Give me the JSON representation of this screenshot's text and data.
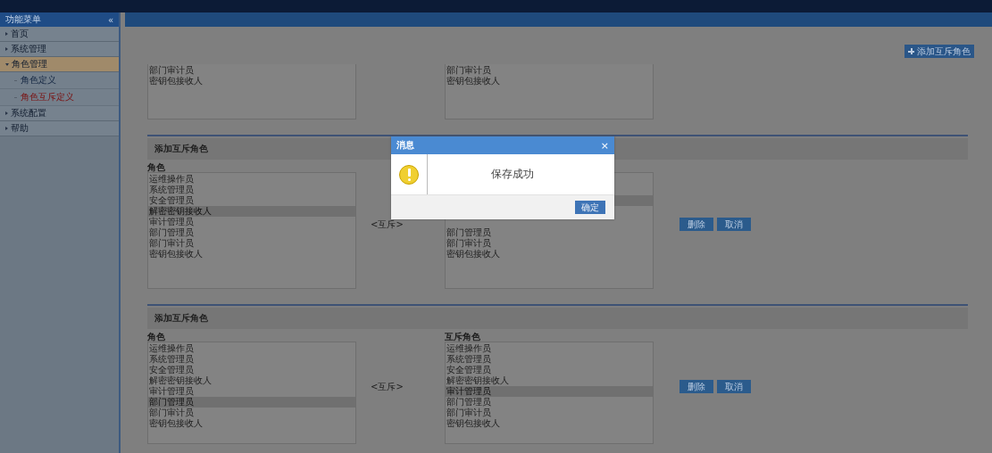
{
  "sidebar": {
    "title": "功能菜单",
    "collapse": "«",
    "items": [
      {
        "label": "首页",
        "expanded": false
      },
      {
        "label": "系统管理",
        "expanded": false
      },
      {
        "label": "角色管理",
        "expanded": true,
        "children": [
          {
            "label": "角色定义",
            "selected": false
          },
          {
            "label": "角色互斥定义",
            "selected": true
          }
        ]
      },
      {
        "label": "系统配置",
        "expanded": false
      },
      {
        "label": "帮助",
        "expanded": false
      }
    ]
  },
  "toolbar": {
    "add_button": "添加互斥角色"
  },
  "sections": [
    {
      "left": {
        "items": [
          {
            "label": "部门审计员",
            "selected": false
          },
          {
            "label": "密钥包接收人",
            "selected": false
          }
        ]
      },
      "right": {
        "items": [
          {
            "label": "部门审计员",
            "selected": false
          },
          {
            "label": "密钥包接收人",
            "selected": false
          }
        ]
      }
    },
    {
      "header": "添加互斥角色",
      "arrow": "<互斥>",
      "buttons": [
        "删除",
        "取消"
      ],
      "left": {
        "label": "角色",
        "items": [
          {
            "label": "运维操作员",
            "selected": false
          },
          {
            "label": "系统管理员",
            "selected": false
          },
          {
            "label": "安全管理员",
            "selected": false
          },
          {
            "label": "解密密钥接收人",
            "selected": true
          },
          {
            "label": "审计管理员",
            "selected": false
          },
          {
            "label": "部门管理员",
            "selected": false
          },
          {
            "label": "部门审计员",
            "selected": false
          },
          {
            "label": "密钥包接收人",
            "selected": false
          }
        ]
      },
      "right": {
        "items": [
          {
            "selected": true
          },
          {
            "label": "部门管理员",
            "selected": false
          },
          {
            "label": "部门审计员",
            "selected": false
          },
          {
            "label": "密钥包接收人",
            "selected": false
          }
        ]
      }
    },
    {
      "header": "添加互斥角色",
      "arrow": "<互斥>",
      "buttons": [
        "删除",
        "取消"
      ],
      "left": {
        "label": "角色",
        "items": [
          {
            "label": "运维操作员",
            "selected": false
          },
          {
            "label": "系统管理员",
            "selected": false
          },
          {
            "label": "安全管理员",
            "selected": false
          },
          {
            "label": "解密密钥接收人",
            "selected": false
          },
          {
            "label": "审计管理员",
            "selected": false
          },
          {
            "label": "部门管理员",
            "selected": true
          },
          {
            "label": "部门审计员",
            "selected": false
          },
          {
            "label": "密钥包接收人",
            "selected": false
          }
        ]
      },
      "right": {
        "label": "互斥角色",
        "items": [
          {
            "label": "运维操作员",
            "selected": false
          },
          {
            "label": "系统管理员",
            "selected": false
          },
          {
            "label": "安全管理员",
            "selected": false
          },
          {
            "label": "解密密钥接收人",
            "selected": false
          },
          {
            "label": "审计管理员",
            "selected": true
          },
          {
            "label": "部门管理员",
            "selected": false
          },
          {
            "label": "部门审计员",
            "selected": false
          },
          {
            "label": "密钥包接收人",
            "selected": false
          }
        ]
      }
    }
  ],
  "dialog": {
    "title": "消息",
    "close": "×",
    "message": "保存成功",
    "ok_button": "确定"
  }
}
